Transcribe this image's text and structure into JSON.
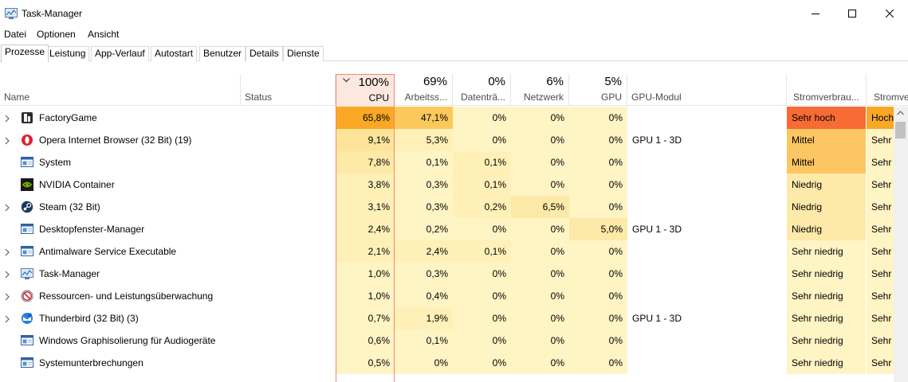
{
  "window": {
    "title": "Task-Manager"
  },
  "menu": [
    "Datei",
    "Optionen",
    "Ansicht"
  ],
  "tabs": [
    "Prozesse",
    "Leistung",
    "App-Verlauf",
    "Autostart",
    "Benutzer",
    "Details",
    "Dienste"
  ],
  "active_tab": "Prozesse",
  "columns": {
    "name": "Name",
    "status": "Status",
    "cpu": {
      "pct": "100%",
      "label": "CPU"
    },
    "memory": {
      "pct": "69%",
      "label": "Arbeitss..."
    },
    "disk": {
      "pct": "0%",
      "label": "Datenträ..."
    },
    "network": {
      "pct": "6%",
      "label": "Netzwerk"
    },
    "gpu": {
      "pct": "5%",
      "label": "GPU"
    },
    "gpu_engine": "GPU-Modul",
    "power": "Stromverbrau...",
    "power_trend": "Stromve"
  },
  "processes": [
    {
      "name": "FactoryGame",
      "icon": "factorygame-icon",
      "expandable": true,
      "cpu": "65,8%",
      "mem": "47,1%",
      "disk": "0%",
      "net": "0%",
      "gpu": "0%",
      "engine": "",
      "power": "Sehr hoch",
      "trend": "Hoch",
      "cpu_color": "#f9a825",
      "mem_color": "#fbc85a",
      "disk_color": "#fff4c4",
      "net_color": "#fff4c4",
      "gpu_color": "#fff4c4",
      "power_color": "#f76b35",
      "trend_color": "#f9a825"
    },
    {
      "name": "Opera Internet Browser (32 Bit) (19)",
      "icon": "opera-icon",
      "expandable": true,
      "cpu": "9,1%",
      "mem": "5,3%",
      "disk": "0%",
      "net": "0%",
      "gpu": "0%",
      "engine": "GPU 1 - 3D",
      "power": "Mittel",
      "trend": "Sehr",
      "cpu_color": "#fde49a",
      "mem_color": "#fff0b8",
      "disk_color": "#fff4c4",
      "net_color": "#fff4c4",
      "gpu_color": "#fff4c4",
      "power_color": "#fcc663",
      "trend_color": "#fff4c4"
    },
    {
      "name": "System",
      "icon": "system-window-icon",
      "expandable": false,
      "cpu": "7,8%",
      "mem": "0,1%",
      "disk": "0,1%",
      "net": "0%",
      "gpu": "0%",
      "engine": "",
      "power": "Mittel",
      "trend": "Sehr",
      "cpu_color": "#fde9a8",
      "mem_color": "#fff4c4",
      "disk_color": "#fff0b8",
      "net_color": "#fff4c4",
      "gpu_color": "#fff4c4",
      "power_color": "#fcc663",
      "trend_color": "#fff4c4"
    },
    {
      "name": "NVIDIA Container",
      "icon": "nvidia-icon",
      "expandable": false,
      "cpu": "3,8%",
      "mem": "0,3%",
      "disk": "0,1%",
      "net": "0%",
      "gpu": "0%",
      "engine": "",
      "power": "Niedrig",
      "trend": "Sehr",
      "cpu_color": "#fff0b8",
      "mem_color": "#fff4c4",
      "disk_color": "#fff0b8",
      "net_color": "#fff4c4",
      "gpu_color": "#fff4c4",
      "power_color": "#fde9a8",
      "trend_color": "#fff4c4"
    },
    {
      "name": "Steam (32 Bit)",
      "icon": "steam-icon",
      "expandable": true,
      "cpu": "3,1%",
      "mem": "0,3%",
      "disk": "0,2%",
      "net": "6,5%",
      "gpu": "0%",
      "engine": "",
      "power": "Niedrig",
      "trend": "Sehr",
      "cpu_color": "#fff0b8",
      "mem_color": "#fff4c4",
      "disk_color": "#fff0b8",
      "net_color": "#fde9a8",
      "gpu_color": "#fff4c4",
      "power_color": "#fde9a8",
      "trend_color": "#fff4c4"
    },
    {
      "name": "Desktopfenster-Manager",
      "icon": "system-window-icon",
      "expandable": false,
      "cpu": "2,4%",
      "mem": "0,2%",
      "disk": "0%",
      "net": "0%",
      "gpu": "5,0%",
      "engine": "GPU 1 - 3D",
      "power": "Niedrig",
      "trend": "Sehr",
      "cpu_color": "#fff0b8",
      "mem_color": "#fff4c4",
      "disk_color": "#fff4c4",
      "net_color": "#fff4c4",
      "gpu_color": "#fde9a8",
      "power_color": "#fde9a8",
      "trend_color": "#fff4c4"
    },
    {
      "name": "Antimalware Service Executable",
      "icon": "system-window-icon",
      "expandable": true,
      "cpu": "2,1%",
      "mem": "2,4%",
      "disk": "0,1%",
      "net": "0%",
      "gpu": "0%",
      "engine": "",
      "power": "Sehr niedrig",
      "trend": "Sehr",
      "cpu_color": "#fff0b8",
      "mem_color": "#fff0b8",
      "disk_color": "#fff0b8",
      "net_color": "#fff4c4",
      "gpu_color": "#fff4c4",
      "power_color": "#fff4c4",
      "trend_color": "#fff4c4"
    },
    {
      "name": "Task-Manager",
      "icon": "taskmanager-icon",
      "expandable": true,
      "cpu": "1,0%",
      "mem": "0,3%",
      "disk": "0%",
      "net": "0%",
      "gpu": "0%",
      "engine": "",
      "power": "Sehr niedrig",
      "trend": "Sehr",
      "cpu_color": "#fff4c4",
      "mem_color": "#fff4c4",
      "disk_color": "#fff4c4",
      "net_color": "#fff4c4",
      "gpu_color": "#fff4c4",
      "power_color": "#fff4c4",
      "trend_color": "#fff4c4"
    },
    {
      "name": "Ressourcen- und Leistungsüberwachung",
      "icon": "resource-monitor-icon",
      "expandable": true,
      "cpu": "1,0%",
      "mem": "0,4%",
      "disk": "0%",
      "net": "0%",
      "gpu": "0%",
      "engine": "",
      "power": "Sehr niedrig",
      "trend": "Sehr",
      "cpu_color": "#fff4c4",
      "mem_color": "#fff4c4",
      "disk_color": "#fff4c4",
      "net_color": "#fff4c4",
      "gpu_color": "#fff4c4",
      "power_color": "#fff4c4",
      "trend_color": "#fff4c4"
    },
    {
      "name": "Thunderbird (32 Bit) (3)",
      "icon": "thunderbird-icon",
      "expandable": true,
      "cpu": "0,7%",
      "mem": "1,9%",
      "disk": "0%",
      "net": "0%",
      "gpu": "0%",
      "engine": "GPU 1 - 3D",
      "power": "Sehr niedrig",
      "trend": "Sehr",
      "cpu_color": "#fff4c4",
      "mem_color": "#fff0b8",
      "disk_color": "#fff4c4",
      "net_color": "#fff4c4",
      "gpu_color": "#fff4c4",
      "power_color": "#fff4c4",
      "trend_color": "#fff4c4"
    },
    {
      "name": "Windows Graphisolierung für Audiogeräte",
      "icon": "system-window-icon",
      "expandable": false,
      "cpu": "0,6%",
      "mem": "0,1%",
      "disk": "0%",
      "net": "0%",
      "gpu": "0%",
      "engine": "",
      "power": "Sehr niedrig",
      "trend": "Sehr",
      "cpu_color": "#fff4c4",
      "mem_color": "#fff4c4",
      "disk_color": "#fff4c4",
      "net_color": "#fff4c4",
      "gpu_color": "#fff4c4",
      "power_color": "#fff4c4",
      "trend_color": "#fff4c4"
    },
    {
      "name": "Systemunterbrechungen",
      "icon": "system-window-icon",
      "expandable": false,
      "cpu": "0,5%",
      "mem": "0%",
      "disk": "0%",
      "net": "0%",
      "gpu": "0%",
      "engine": "",
      "power": "Sehr niedrig",
      "trend": "Sehr",
      "cpu_color": "#fff4c4",
      "mem_color": "#fff4c4",
      "disk_color": "#fff4c4",
      "net_color": "#fff4c4",
      "gpu_color": "#fff4c4",
      "power_color": "#fff4c4",
      "trend_color": "#fff4c4"
    }
  ]
}
